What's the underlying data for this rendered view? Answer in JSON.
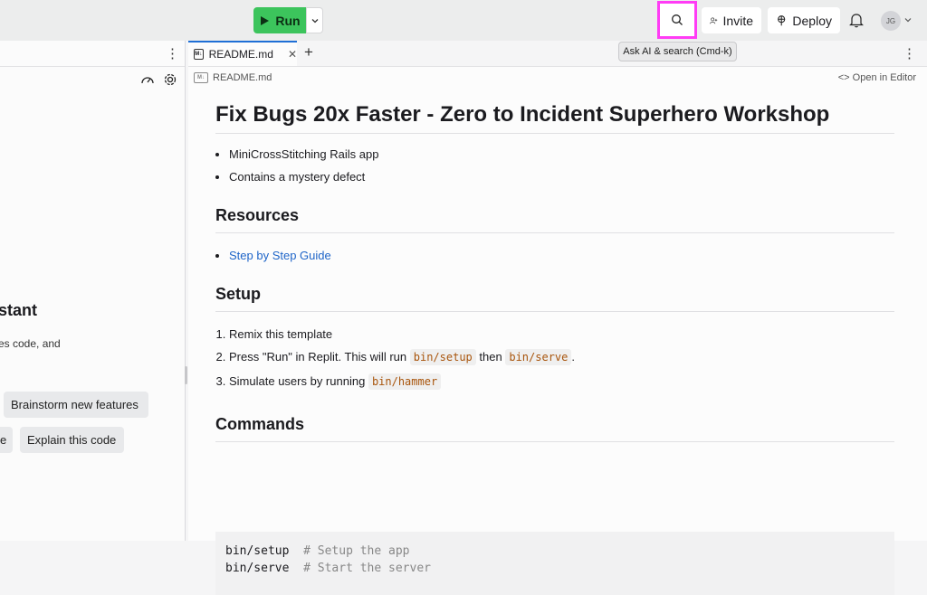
{
  "topbar": {
    "run_label": "Run",
    "invite_label": "Invite",
    "deploy_label": "Deploy",
    "avatar_initials": "JG",
    "tooltip": "Ask AI & search (Cmd-k)"
  },
  "left_panel": {
    "assistant_title": "stant",
    "assistant_subtitle": "es code, and",
    "chips": [
      "Brainstorm new features",
      "e",
      "Explain this code"
    ]
  },
  "editor": {
    "tab_label": "README.md",
    "breadcrumb": "README.md",
    "open_in_editor": "Open in Editor"
  },
  "readme": {
    "title": "Fix Bugs 20x Faster - Zero to Incident Superhero Workshop",
    "bullets": [
      "MiniCrossStitching Rails app",
      "Contains a mystery defect"
    ],
    "resources_heading": "Resources",
    "resources_link": "Step by Step Guide",
    "setup_heading": "Setup",
    "setup_step1": "Remix this template",
    "setup_step2_pre": "Press \"Run\" in Replit. This will run",
    "setup_step2_code1": "bin/setup",
    "setup_step2_mid": "then",
    "setup_step2_code2": "bin/serve",
    "setup_step2_post": ".",
    "setup_step3_pre": "Simulate users by running",
    "setup_step3_code": "bin/hammer",
    "commands_heading": "Commands",
    "commands": [
      {
        "cmd": "bin/setup",
        "comment": "# Setup the app"
      },
      {
        "cmd": "bin/serve",
        "comment": "# Start the server"
      }
    ]
  },
  "colors": {
    "run_green": "#3cc45c",
    "highlight": "#ff3cf5",
    "link": "#1f65c8",
    "code_text": "#a8540b"
  }
}
